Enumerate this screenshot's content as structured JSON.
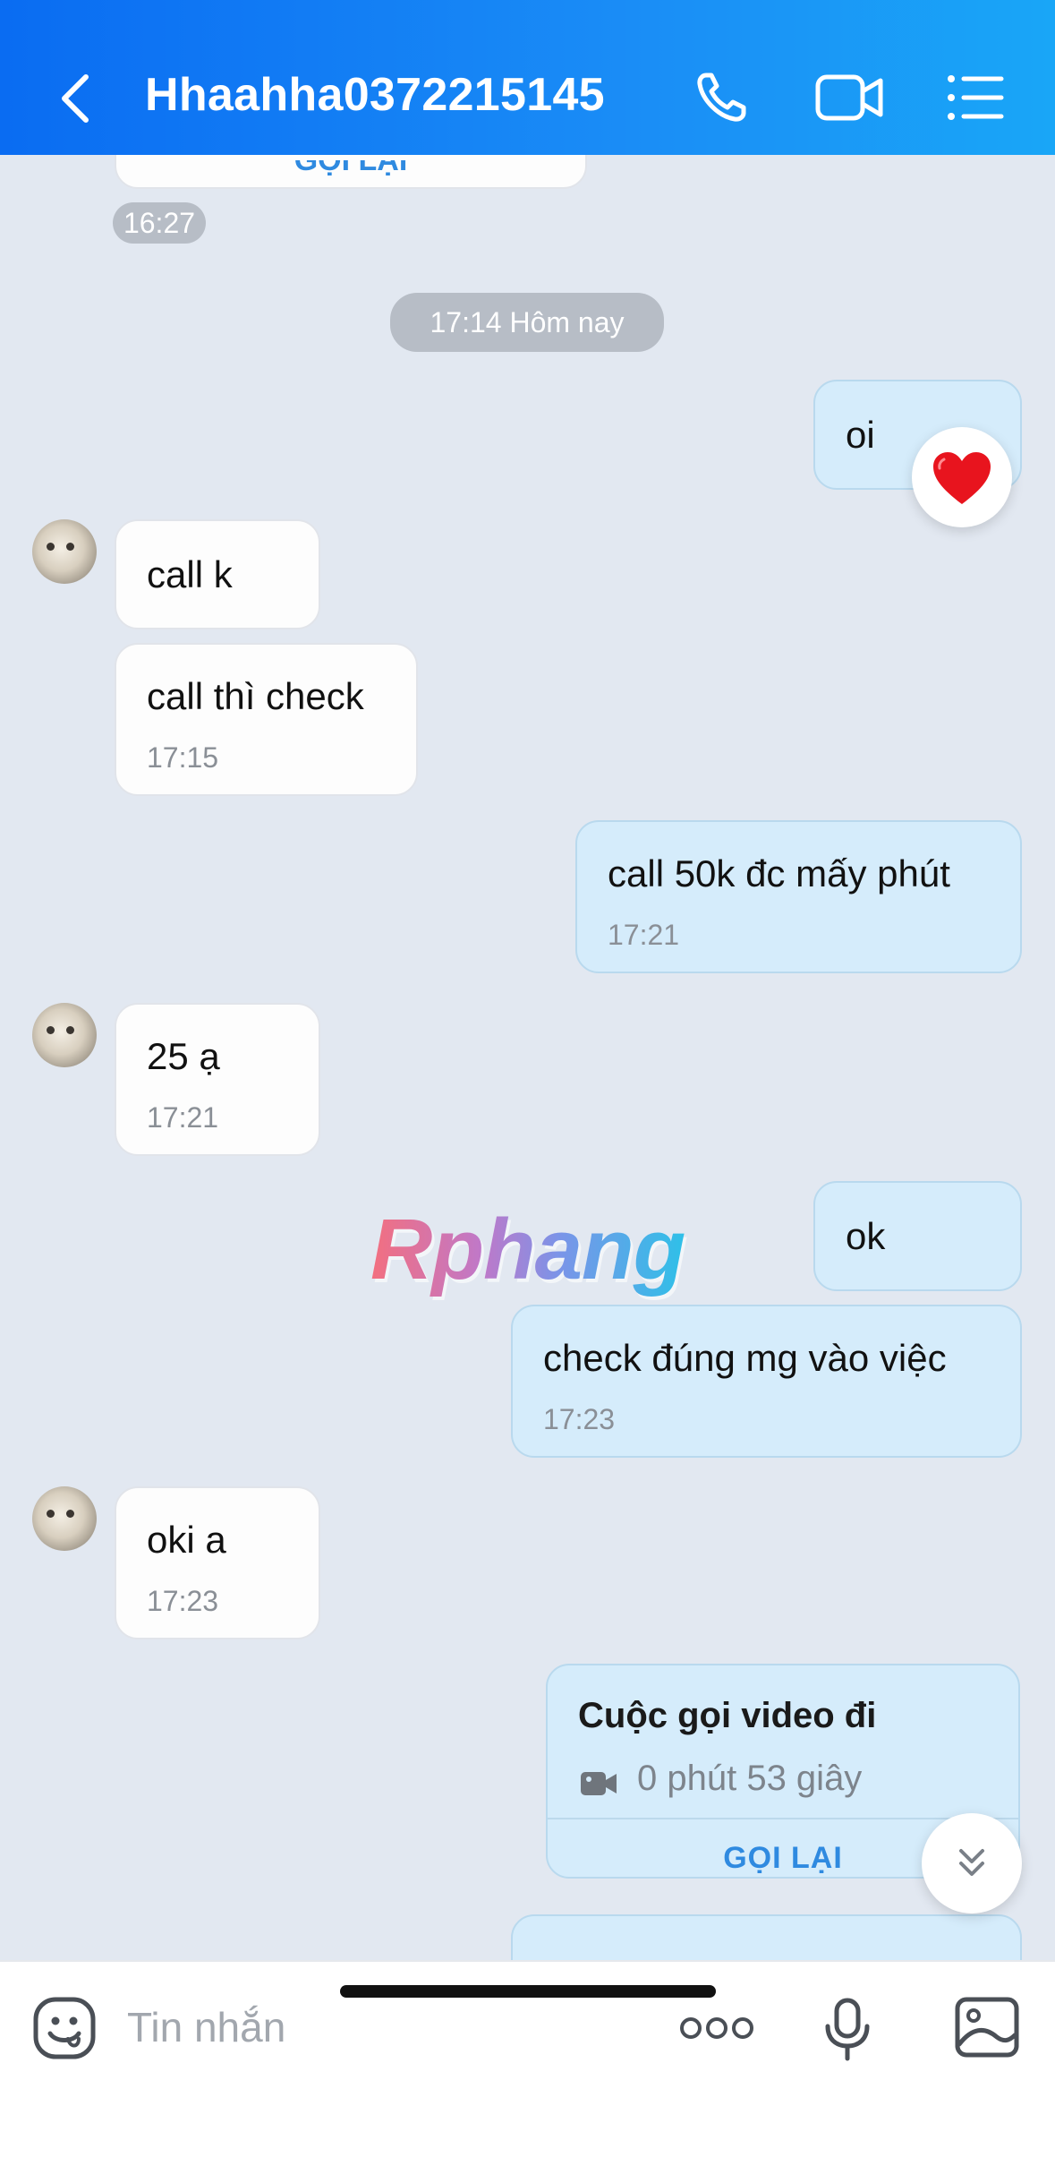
{
  "header": {
    "title": "Hhaahha0372215145",
    "icons": [
      "back-chevron-icon",
      "phone-icon",
      "video-call-icon",
      "list-menu-icon"
    ]
  },
  "chat": {
    "prev_card_callback": "GỌI LẠI",
    "prev_time": "16:27",
    "date_separator": "17:14 Hôm nay",
    "messages": [
      {
        "dir": "out",
        "text": "oi",
        "time": "",
        "reaction": "heart"
      },
      {
        "dir": "in",
        "text": "call k",
        "time": ""
      },
      {
        "dir": "in",
        "text": "call thì check",
        "time": "17:15"
      },
      {
        "dir": "out",
        "text": "call 50k đc mấy phút",
        "time": "17:21"
      },
      {
        "dir": "in",
        "text": "25 ạ",
        "time": "17:21"
      },
      {
        "dir": "out",
        "text": "ok",
        "time": ""
      },
      {
        "dir": "out",
        "text": "check đúng mg vào việc",
        "time": "17:23"
      },
      {
        "dir": "in",
        "text": "oki a",
        "time": "17:23"
      }
    ],
    "call_card": {
      "title": "Cuộc gọi video đi",
      "duration": "0 phút 53 giây",
      "callback": "GỌI LẠI"
    },
    "watermark": "Rphang"
  },
  "composer": {
    "placeholder": "Tin nhắn",
    "icons": [
      "sticker-icon",
      "more-dots-icon",
      "microphone-icon",
      "image-icon"
    ]
  },
  "colors": {
    "header": "#1a8df6",
    "background": "#e2e8f1",
    "incoming": "#fdfdfd",
    "outgoing": "#d5ecfb",
    "accent": "#2f8ae0"
  }
}
